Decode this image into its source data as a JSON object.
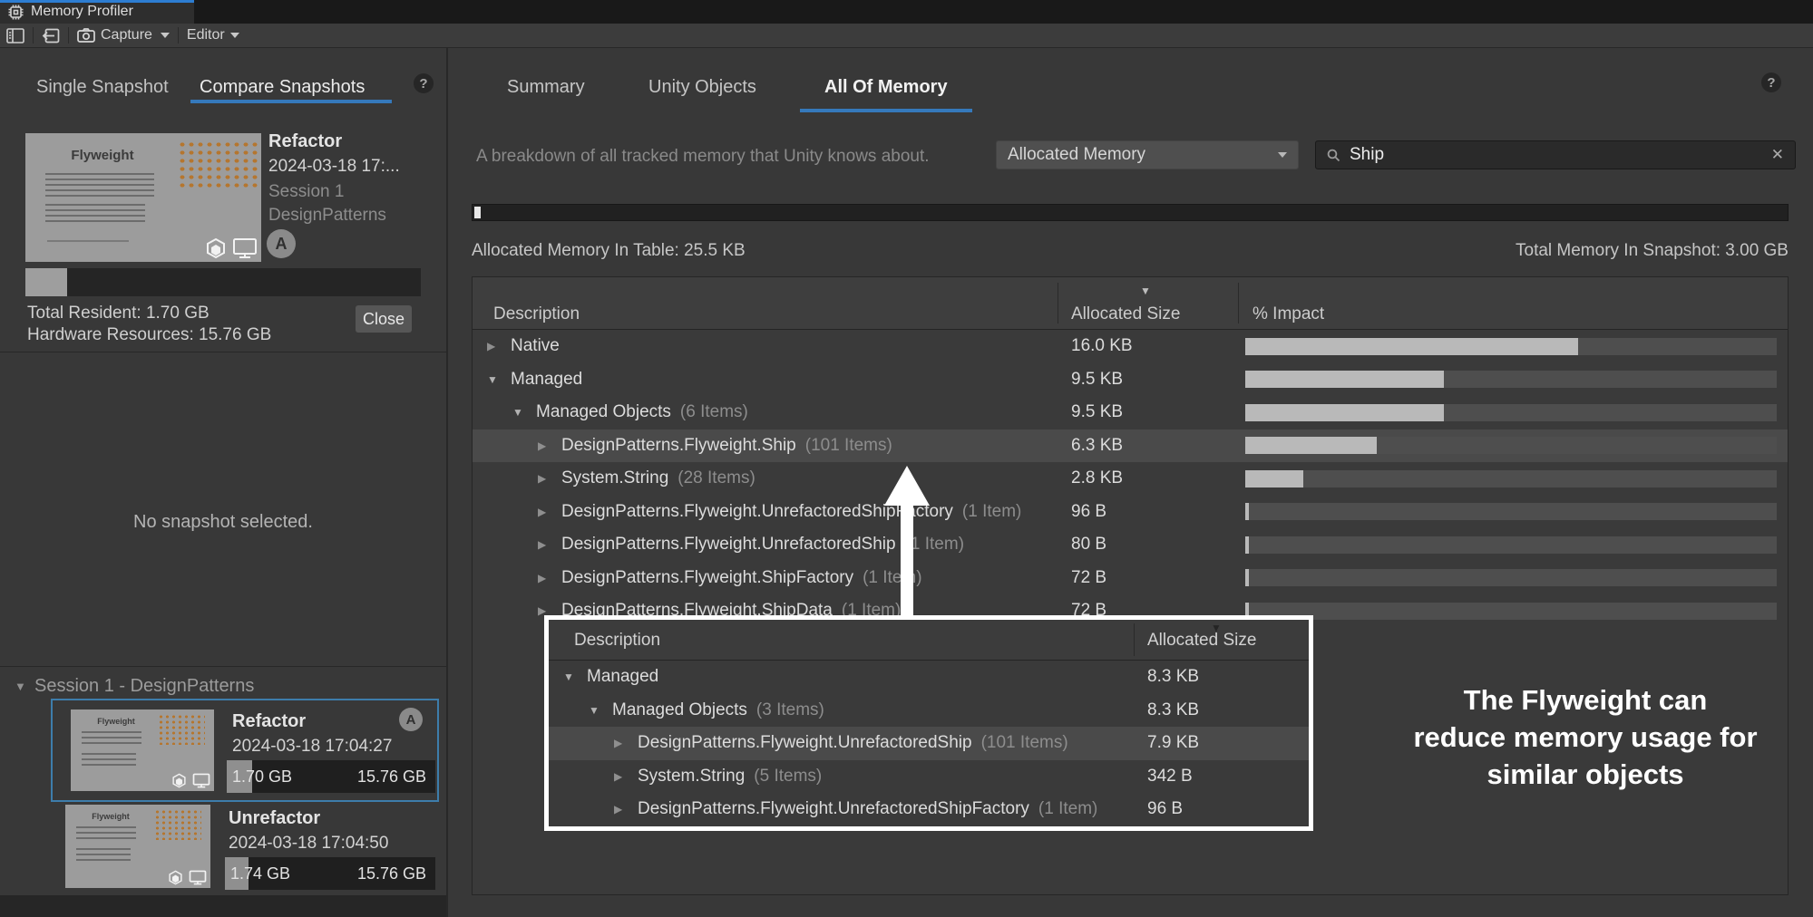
{
  "window": {
    "title": "Memory Profiler"
  },
  "toolbar": {
    "capture_label": "Capture",
    "editor_label": "Editor"
  },
  "sidebar": {
    "tabs": [
      {
        "label": "Single Snapshot",
        "active": false
      },
      {
        "label": "Compare Snapshots",
        "active": true
      }
    ],
    "detail_card": {
      "thumb_title": "Flyweight",
      "name": "Refactor",
      "date": "2024-03-18 17:...",
      "session": "Session 1",
      "project": "DesignPatterns",
      "avatar": "A",
      "bar_fill_pct": 10.5,
      "total_resident": "Total Resident: 1.70 GB",
      "hardware_resources": "Hardware Resources: 15.76 GB",
      "close_label": "Close"
    },
    "empty_message": "No snapshot selected.",
    "session_header": "Session 1 - DesignPatterns",
    "snapshots": [
      {
        "thumb_title": "Flyweight",
        "name": "Refactor",
        "date": "2024-03-18 17:04:27",
        "size": "1.70 GB",
        "total": "15.76 GB",
        "badge": "A",
        "selected": true,
        "bar_fill_pct": 12
      },
      {
        "thumb_title": "Flyweight",
        "name": "Unrefactor",
        "date": "2024-03-18 17:04:50",
        "size": "1.74 GB",
        "total": "15.76 GB",
        "badge": "",
        "selected": false,
        "bar_fill_pct": 11
      }
    ]
  },
  "main": {
    "tabs": [
      {
        "label": "Summary",
        "active": false
      },
      {
        "label": "Unity Objects",
        "active": false
      },
      {
        "label": "All Of Memory",
        "active": true
      }
    ],
    "description": "A breakdown of all tracked memory that Unity knows about.",
    "filter_dropdown_value": "Allocated Memory",
    "search_value": "Ship",
    "usage_bar_pct": 0.5,
    "allocated_in_table": "Allocated Memory In Table: 25.5 KB",
    "total_in_snapshot": "Total Memory In Snapshot: 3.00 GB",
    "table": {
      "columns": [
        "Description",
        "Allocated Size",
        "% Impact"
      ],
      "sorted_column": "Allocated Size",
      "rows": [
        {
          "level": 1,
          "expanded": false,
          "label": "Native",
          "count": "",
          "size": "16.0 KB",
          "impact_pct": 62.7,
          "highlight": false
        },
        {
          "level": 1,
          "expanded": true,
          "label": "Managed",
          "count": "",
          "size": "9.5 KB",
          "impact_pct": 37.3,
          "highlight": false
        },
        {
          "level": 2,
          "expanded": true,
          "label": "Managed Objects",
          "count": "(6 Items)",
          "size": "9.5 KB",
          "impact_pct": 37.3,
          "highlight": false
        },
        {
          "level": 3,
          "expanded": false,
          "label": "DesignPatterns.Flyweight.Ship",
          "count": "(101 Items)",
          "size": "6.3 KB",
          "impact_pct": 24.7,
          "highlight": true
        },
        {
          "level": 3,
          "expanded": false,
          "label": "System.String",
          "count": "(28 Items)",
          "size": "2.8 KB",
          "impact_pct": 11.0,
          "highlight": false
        },
        {
          "level": 3,
          "expanded": false,
          "label": "DesignPatterns.Flyweight.UnrefactoredShipFactory",
          "count": "(1 Item)",
          "size": "96 B",
          "impact_pct": 0.7,
          "highlight": false
        },
        {
          "level": 3,
          "expanded": false,
          "label": "DesignPatterns.Flyweight.UnrefactoredShip",
          "count": "(1 Item)",
          "size": "80 B",
          "impact_pct": 0.6,
          "highlight": false
        },
        {
          "level": 3,
          "expanded": false,
          "label": "DesignPatterns.Flyweight.ShipFactory",
          "count": "(1 Item)",
          "size": "72 B",
          "impact_pct": 0.55,
          "highlight": false
        },
        {
          "level": 3,
          "expanded": false,
          "label": "DesignPatterns.Flyweight.ShipData",
          "count": "(1 Item)",
          "size": "72 B",
          "impact_pct": 0.55,
          "highlight": false
        }
      ]
    }
  },
  "popup": {
    "columns": [
      "Description",
      "Allocated Size"
    ],
    "sorted_column": "Allocated Size",
    "rows": [
      {
        "level": 1,
        "expanded": true,
        "label": "Managed",
        "count": "",
        "size": "8.3 KB",
        "highlight": false
      },
      {
        "level": 2,
        "expanded": true,
        "label": "Managed Objects",
        "count": "(3 Items)",
        "size": "8.3 KB",
        "highlight": false
      },
      {
        "level": 3,
        "expanded": false,
        "label": "DesignPatterns.Flyweight.UnrefactoredShip",
        "count": "(101 Items)",
        "size": "7.9 KB",
        "highlight": true
      },
      {
        "level": 3,
        "expanded": false,
        "label": "System.String",
        "count": "(5 Items)",
        "size": "342 B",
        "highlight": false
      },
      {
        "level": 3,
        "expanded": false,
        "label": "DesignPatterns.Flyweight.UnrefactoredShipFactory",
        "count": "(1 Item)",
        "size": "96 B",
        "highlight": false
      }
    ]
  },
  "annotation": {
    "lines": [
      "The Flyweight can",
      "reduce memory usage for",
      "similar objects"
    ]
  },
  "colors": {
    "accent_blue": "#3579bb",
    "selection_blue": "#3d7dab",
    "impact_fill": "#b9b9b9",
    "popup_border": "#ffffff",
    "thumbnail_gray": "#9c9c9c",
    "ship_dot_orange": "#b5762f"
  }
}
